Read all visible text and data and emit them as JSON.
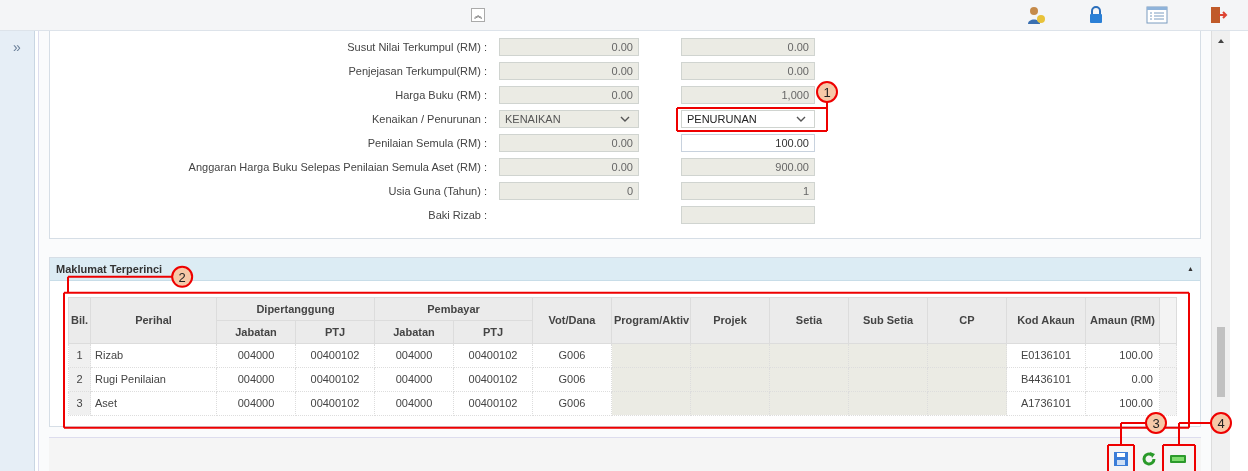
{
  "toolbar": {
    "collapse_button": "︽"
  },
  "sidebar": {
    "expand_button": "»"
  },
  "form": {
    "rows": [
      {
        "label": "Susut Nilai Terkumpul (RM) :",
        "fields": [
          {
            "kind": "readonly",
            "value": "0.00"
          },
          {
            "kind": "readonly",
            "value": "0.00"
          }
        ]
      },
      {
        "label": "Penjejasan Terkumpul(RM) :",
        "fields": [
          {
            "kind": "readonly",
            "value": "0.00"
          },
          {
            "kind": "readonly",
            "value": "0.00"
          }
        ]
      },
      {
        "label": "Harga Buku (RM) :",
        "fields": [
          {
            "kind": "readonly",
            "value": "0.00"
          },
          {
            "kind": "readonly",
            "value": "1,000"
          }
        ]
      },
      {
        "label": "Kenaikan / Penurunan :",
        "fields": [
          {
            "kind": "select",
            "value": "KENAIKAN",
            "disabled": true
          },
          {
            "kind": "select",
            "value": "PENURUNAN",
            "disabled": false
          }
        ]
      },
      {
        "label": "Penilaian Semula (RM) :",
        "fields": [
          {
            "kind": "readonly",
            "value": "0.00"
          },
          {
            "kind": "editable",
            "value": "100.00"
          }
        ]
      },
      {
        "label": "Anggaran Harga Buku Selepas Penilaian Semula Aset (RM) :",
        "fields": [
          {
            "kind": "readonly",
            "value": "0.00"
          },
          {
            "kind": "readonly",
            "value": "900.00"
          }
        ]
      },
      {
        "label": "Usia Guna (Tahun) :",
        "fields": [
          {
            "kind": "readonly",
            "value": "0"
          },
          {
            "kind": "readonly",
            "value": "1"
          }
        ]
      },
      {
        "label": "Baki Rizab :",
        "fields": [
          {
            "kind": "none"
          },
          {
            "kind": "readonly"
          }
        ]
      }
    ]
  },
  "detail": {
    "title": "Maklumat Terperinci",
    "collapse_button": "▲",
    "table": {
      "groups": [
        {
          "label": "Bil."
        },
        {
          "label": "Perihal"
        },
        {
          "label": "Dipertanggung",
          "subcolumns": [
            "Jabatan",
            "PTJ"
          ]
        },
        {
          "label": "Pembayar",
          "subcolumns": [
            "Jabatan",
            "PTJ"
          ]
        },
        {
          "label": "Vot/Dana"
        },
        {
          "label": "Program/Aktiv"
        },
        {
          "label": "Projek"
        },
        {
          "label": "Setia"
        },
        {
          "label": "Sub Setia"
        },
        {
          "label": "CP"
        },
        {
          "label": "Kod Akaun"
        },
        {
          "label": "Amaun (RM)"
        }
      ],
      "rows": [
        [
          "1",
          "Rizab",
          "004000",
          "00400102",
          "004000",
          "00400102",
          "G006",
          "",
          "",
          "",
          "",
          "",
          "E0136101",
          "100.00"
        ],
        [
          "2",
          "Rugi Penilaian",
          "004000",
          "00400102",
          "004000",
          "00400102",
          "G006",
          "",
          "",
          "",
          "",
          "",
          "B4436101",
          "0.00"
        ],
        [
          "3",
          "Aset",
          "004000",
          "00400102",
          "004000",
          "00400102",
          "G006",
          "",
          "",
          "",
          "",
          "",
          "A1736101",
          "100.00"
        ]
      ]
    }
  },
  "annotations": [
    {
      "number": "1"
    },
    {
      "number": "2"
    },
    {
      "number": "3"
    },
    {
      "number": "4"
    }
  ]
}
